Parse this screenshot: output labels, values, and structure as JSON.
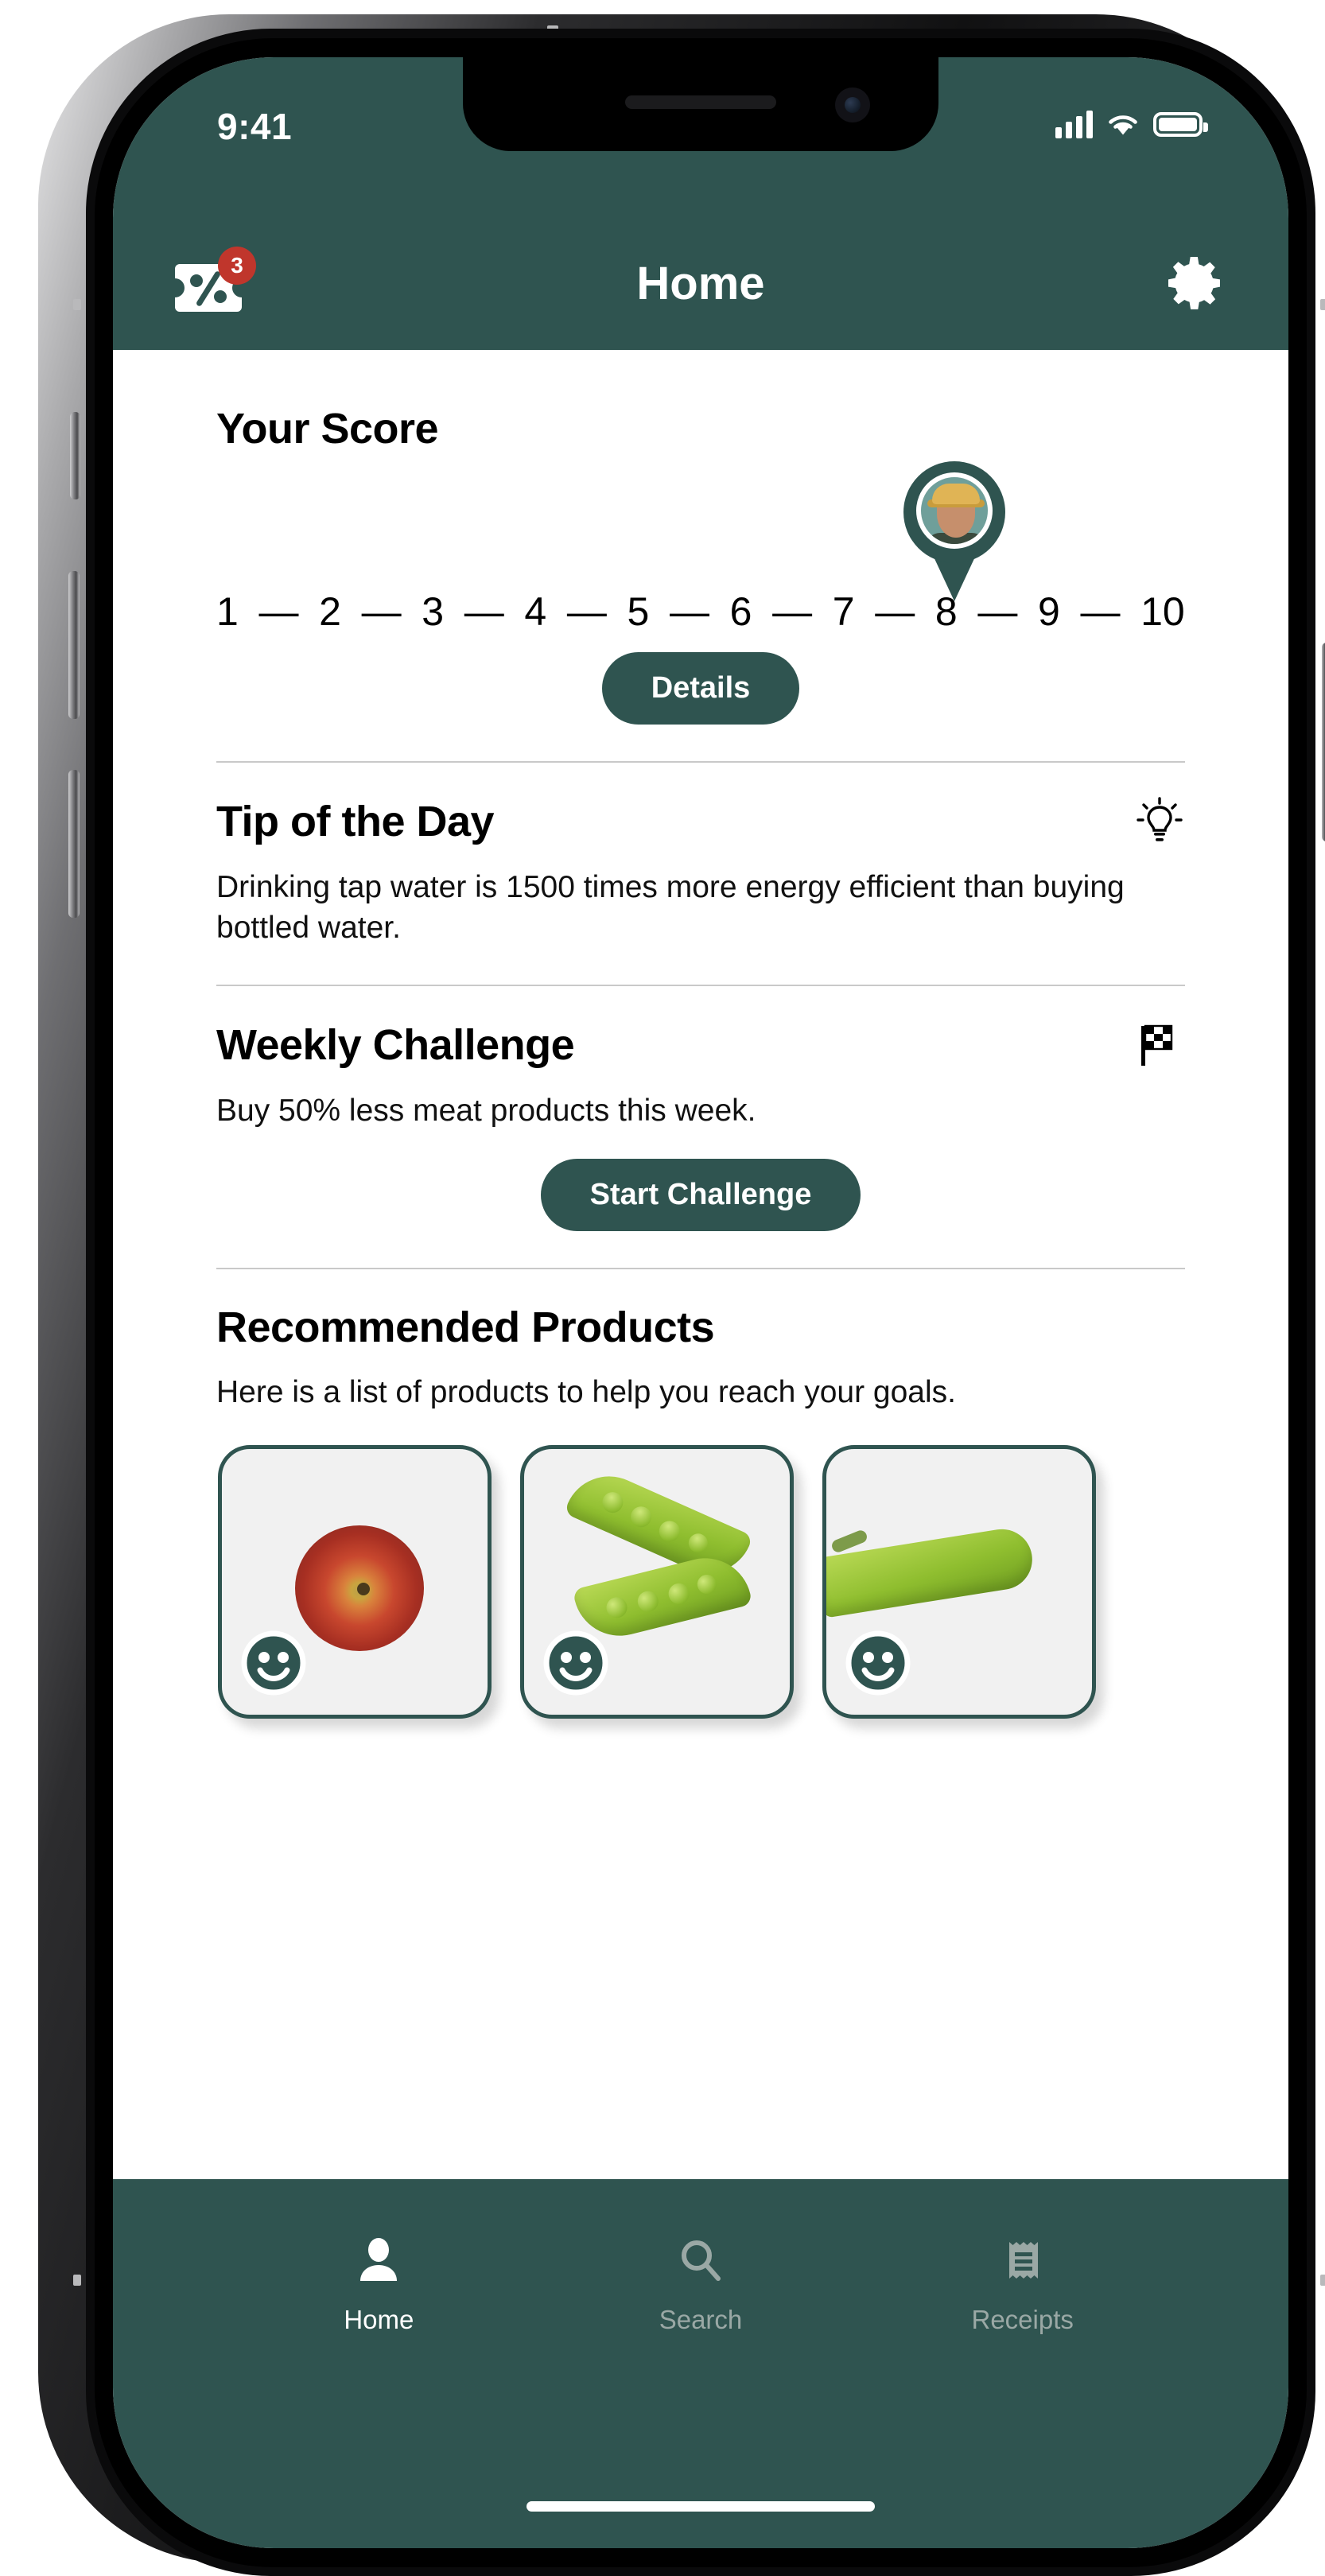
{
  "status_bar": {
    "time": "9:41",
    "signal_icon": "signal-bars-icon",
    "wifi_icon": "wifi-icon",
    "battery_icon": "battery-icon"
  },
  "header": {
    "title": "Home",
    "left_icon": "coupon-discount-icon",
    "badge_count": "3",
    "right_icon": "gear-icon",
    "background_color": "#2f5450"
  },
  "score": {
    "heading": "Your Score",
    "scale": [
      "1",
      "2",
      "3",
      "4",
      "5",
      "6",
      "7",
      "8",
      "9",
      "10"
    ],
    "separator": "—",
    "current_value": "7.5",
    "marker_icon": "map-pin-avatar-icon",
    "details_button": "Details"
  },
  "tip": {
    "heading": "Tip of the Day",
    "icon": "lightbulb-icon",
    "text": "Drinking tap water is 1500 times more energy efficient than buying bottled water."
  },
  "challenge": {
    "heading": "Weekly Challenge",
    "icon": "checkered-flag-icon",
    "text": "Buy 50% less meat products this week.",
    "start_button": "Start Challenge"
  },
  "products": {
    "heading": "Recommended Products",
    "description": "Here is a list of products to help you reach your goals.",
    "items": [
      {
        "image": "apple-photo",
        "rating_icon": "smiley-face-icon"
      },
      {
        "image": "pea-pods-photo",
        "rating_icon": "smiley-face-icon"
      },
      {
        "image": "green-bean-photo",
        "rating_icon": "smiley-face-icon"
      }
    ]
  },
  "tab_bar": {
    "items": [
      {
        "label": "Home",
        "icon": "person-icon",
        "active": true
      },
      {
        "label": "Search",
        "icon": "search-icon",
        "active": false
      },
      {
        "label": "Receipts",
        "icon": "receipt-icon",
        "active": false
      }
    ],
    "active_color": "#ffffff",
    "inactive_color": "#9aa8a5"
  },
  "theme": {
    "brand_green": "#2f5450",
    "badge_red": "#c0362c"
  }
}
